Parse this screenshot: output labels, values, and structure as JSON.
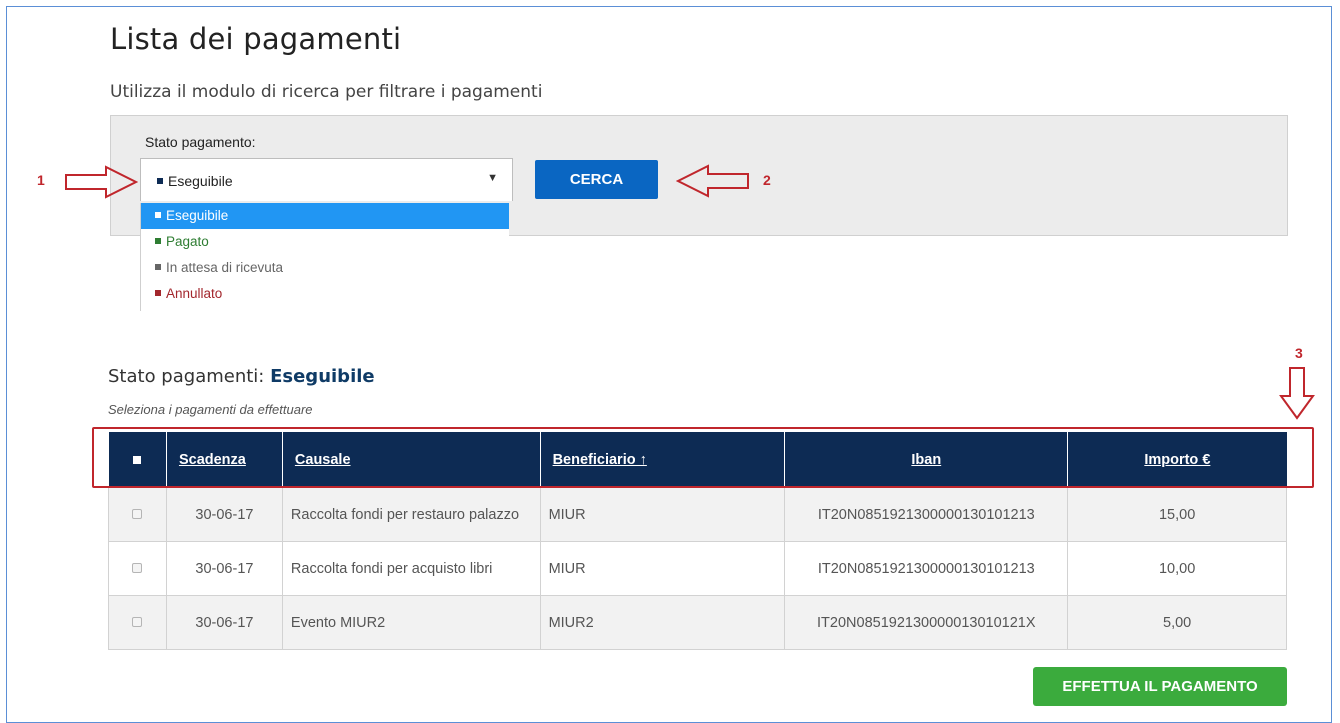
{
  "page": {
    "title": "Lista dei pagamenti",
    "subtitle": "Utilizza il modulo di ricerca per filtrare i pagamenti"
  },
  "filter": {
    "label": "Stato pagamento:",
    "selected": "Eseguibile",
    "options": [
      {
        "label": "Eseguibile",
        "color": "#ffffff"
      },
      {
        "label": "Pagato",
        "color": "#2e7d32"
      },
      {
        "label": "In attesa di ricevuta",
        "color": "#666666"
      },
      {
        "label": "Annullato",
        "color": "#a3272d"
      }
    ],
    "search_button": "CERCA"
  },
  "annotations": [
    "1",
    "2",
    "3"
  ],
  "results": {
    "state_label": "Stato pagamenti:",
    "state_value": "Eseguibile",
    "hint": "Seleziona i pagamenti da effettuare"
  },
  "table": {
    "headers": [
      "Scadenza",
      "Causale",
      "Beneficiario ↑",
      "Iban",
      "Importo €"
    ],
    "rows": [
      [
        "30-06-17",
        "Raccolta fondi per restauro palazzo",
        "MIUR",
        "IT20N0851921300000130101213",
        "15,00"
      ],
      [
        "30-06-17",
        "Raccolta fondi per acquisto libri",
        "MIUR",
        "IT20N0851921300000130101213",
        "10,00"
      ],
      [
        "30-06-17",
        "Evento MIUR2",
        "MIUR2",
        "IT20N085192130000013010121X",
        "5,00"
      ]
    ]
  },
  "actions": {
    "pay_button": "EFFETTUA IL PAGAMENTO"
  },
  "colors": {
    "primary_blue": "#0a66c2",
    "table_header": "#0d2b54",
    "highlight_blue": "#2196f3",
    "success_green": "#3bab3d",
    "annotation_red": "#c0262c"
  }
}
